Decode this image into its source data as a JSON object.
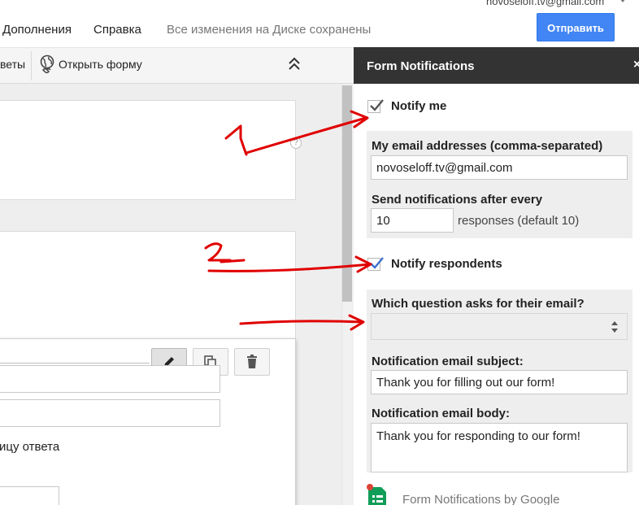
{
  "account": {
    "email": "novoseloff.tv@gmail.com"
  },
  "menu": {
    "items": [
      "Дополнения",
      "Справка"
    ],
    "status": "Все изменения на Диске сохранены"
  },
  "send_button": {
    "label": "Отправить"
  },
  "toolbar": {
    "answers_label": "веты",
    "open_form_label": "Открыть форму"
  },
  "form_editor": {
    "answer_sheet_text": "ицу ответа",
    "help_mark": "?"
  },
  "panel": {
    "title": "Form Notifications",
    "close": "×",
    "notify_me": {
      "label": "Notify me",
      "checked": true
    },
    "my_email": {
      "label": "My email addresses (comma-separated)",
      "value": "novoseloff.tv@gmail.com"
    },
    "send_after": {
      "label": "Send notifications after every",
      "value": "10",
      "suffix": "responses (default 10)"
    },
    "notify_respondents": {
      "label": "Notify respondents",
      "checked": true
    },
    "email_question": {
      "label": "Which question asks for their email?",
      "value": ""
    },
    "subject": {
      "label": "Notification email subject:",
      "value": "Thank you for filling out our form!"
    },
    "body": {
      "label": "Notification email body:",
      "value": "Thank you for responding to our form!"
    },
    "footer": "Form Notifications by Google"
  },
  "annotations": {
    "mark1": "1",
    "mark2": "2"
  },
  "colors": {
    "panel_header": "#333333",
    "send_button": "#4285f4",
    "accent_annotation": "#e00000",
    "grey_box": "#eeeeee"
  }
}
